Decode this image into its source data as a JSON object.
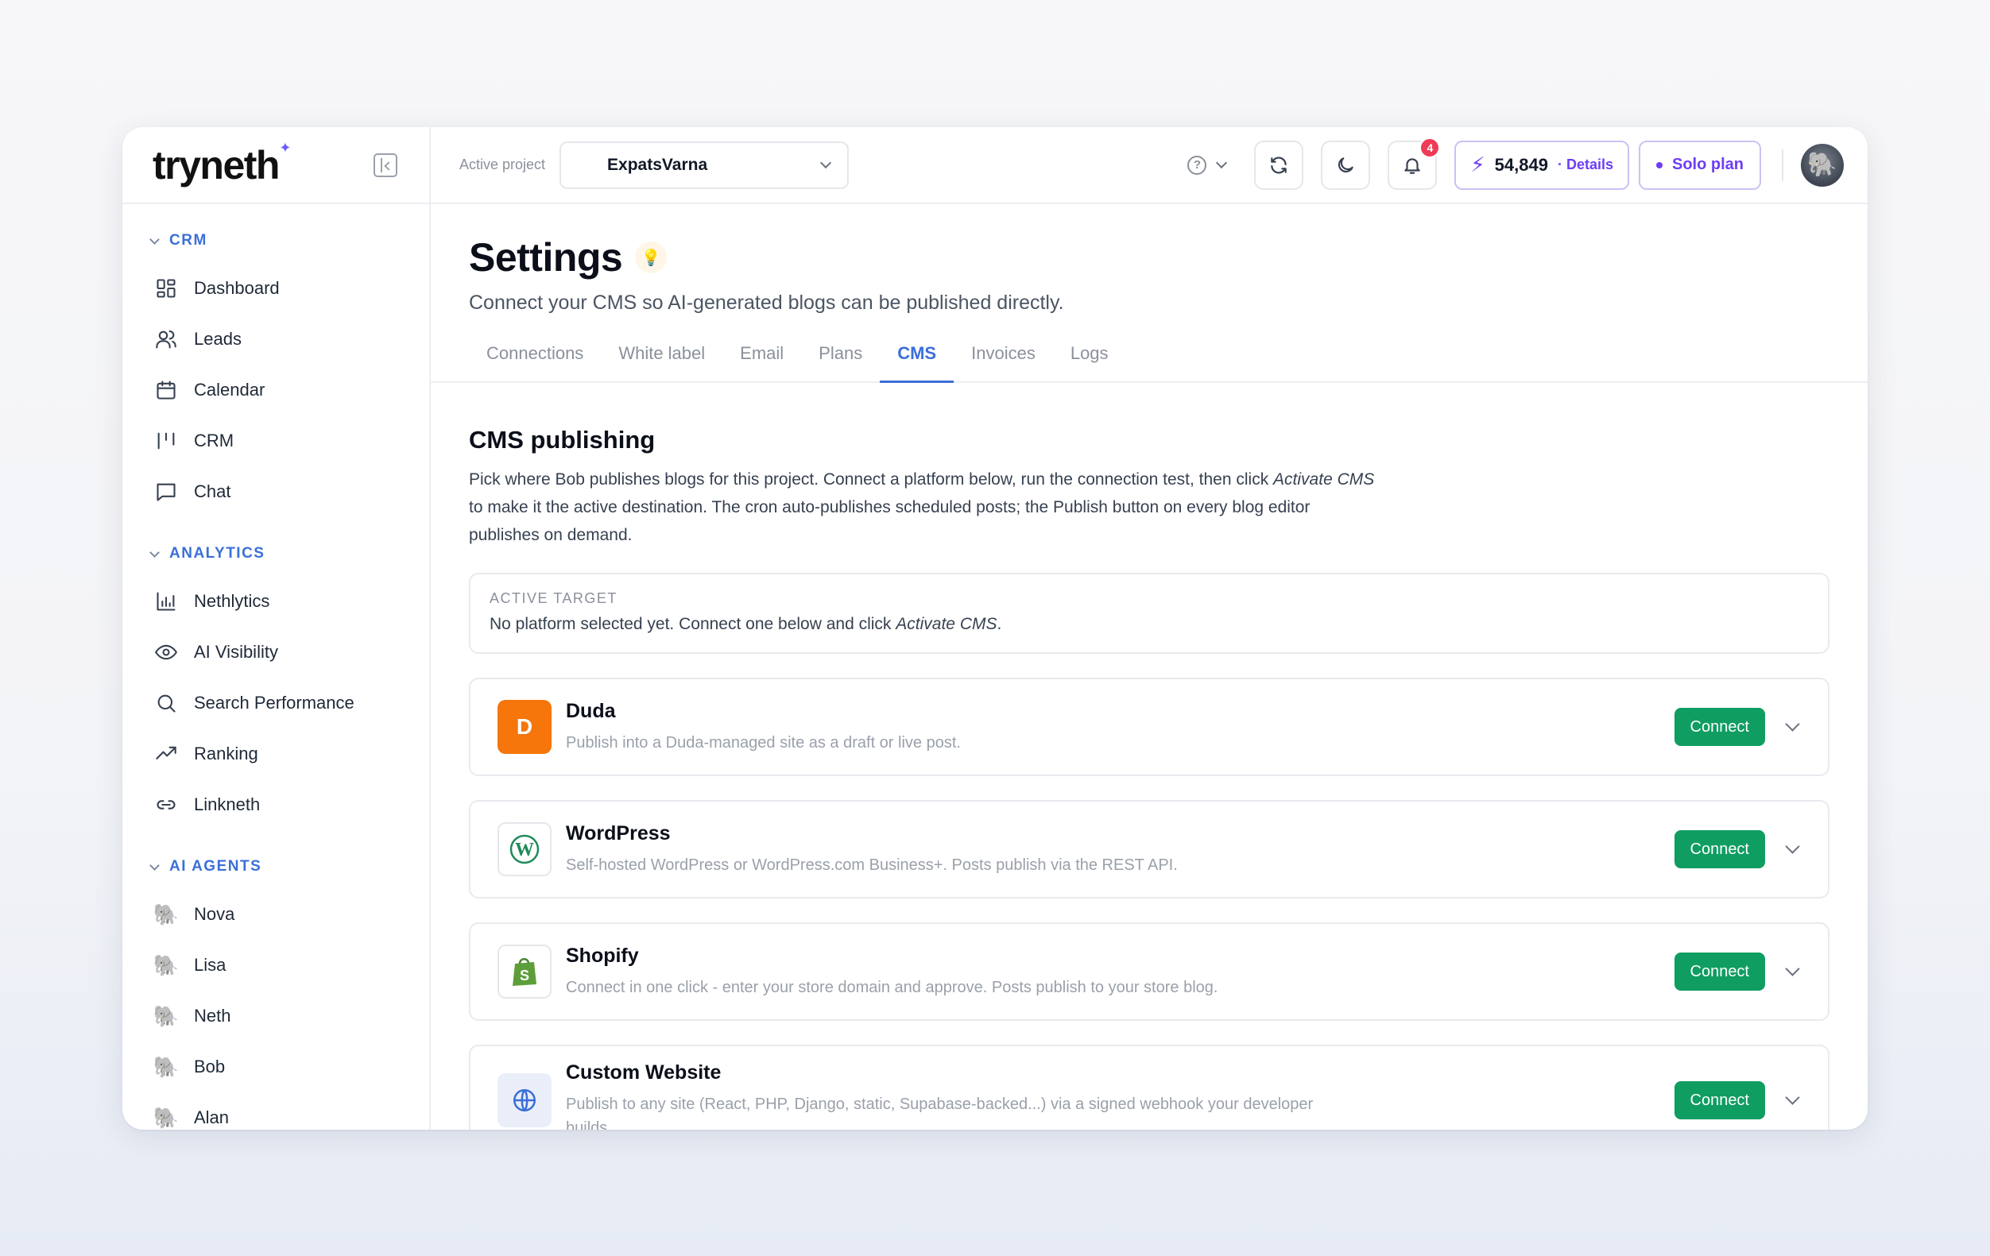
{
  "app": {
    "logo": "tryneth",
    "logo_spark": "✦"
  },
  "sidebar": {
    "sections": [
      {
        "label": "CRM",
        "items": [
          {
            "label": "Dashboard",
            "icon": "dashboard-icon"
          },
          {
            "label": "Leads",
            "icon": "users-icon"
          },
          {
            "label": "Calendar",
            "icon": "calendar-icon"
          },
          {
            "label": "CRM",
            "icon": "kanban-icon"
          },
          {
            "label": "Chat",
            "icon": "chat-icon"
          }
        ]
      },
      {
        "label": "ANALYTICS",
        "items": [
          {
            "label": "Nethlytics",
            "icon": "bar-chart-icon"
          },
          {
            "label": "AI Visibility",
            "icon": "eye-icon"
          },
          {
            "label": "Search Performance",
            "icon": "search-icon"
          },
          {
            "label": "Ranking",
            "icon": "trending-up-icon"
          },
          {
            "label": "Linkneth",
            "icon": "link-icon"
          }
        ]
      },
      {
        "label": "AI AGENTS",
        "items": [
          {
            "label": "Nova",
            "icon": "agent-avatar-icon"
          },
          {
            "label": "Lisa",
            "icon": "agent-avatar-icon"
          },
          {
            "label": "Neth",
            "icon": "agent-avatar-icon"
          },
          {
            "label": "Bob",
            "icon": "agent-avatar-icon"
          },
          {
            "label": "Alan",
            "icon": "agent-avatar-icon"
          }
        ]
      }
    ]
  },
  "topbar": {
    "active_project_label": "Active project",
    "active_project": "ExpatsVarna",
    "notifications_count": "4",
    "credits": "54,849",
    "credits_link": "· Details",
    "plan": "Solo plan"
  },
  "page": {
    "title": "Settings",
    "subtitle": "Connect your CMS so AI-generated blogs can be published directly.",
    "tabs": [
      {
        "label": "Connections",
        "active": false
      },
      {
        "label": "White label",
        "active": false
      },
      {
        "label": "Email",
        "active": false
      },
      {
        "label": "Plans",
        "active": false
      },
      {
        "label": "CMS",
        "active": true
      },
      {
        "label": "Invoices",
        "active": false
      },
      {
        "label": "Logs",
        "active": false
      }
    ]
  },
  "cms": {
    "title": "CMS publishing",
    "desc_1": "Pick where Bob publishes blogs for this project. Connect a platform below, run the connection test, then click ",
    "desc_em": "Activate CMS",
    "desc_2": " to make it the active destination. The cron auto-publishes scheduled posts; the Publish button on every blog editor publishes on demand.",
    "active_target_label": "ACTIVE TARGET",
    "active_target_text": "No platform selected yet. Connect one below and click ",
    "active_target_em": "Activate CMS",
    "active_target_end": ".",
    "connect_label": "Connect",
    "platforms": [
      {
        "name": "Duda",
        "desc": "Publish into a Duda-managed site as a draft or live post.",
        "logo_letter": "D"
      },
      {
        "name": "WordPress",
        "desc": "Self-hosted WordPress or WordPress.com Business+. Posts publish via the REST API."
      },
      {
        "name": "Shopify",
        "desc": "Connect in one click - enter your store domain and approve. Posts publish to your store blog."
      },
      {
        "name": "Custom Website",
        "desc": "Publish to any site (React, PHP, Django, static, Supabase-backed...) via a signed webhook your developer builds."
      }
    ]
  },
  "colors": {
    "accent": "#3b6fd8",
    "brand_purple": "#6d3df5",
    "connect_green": "#0f9d62",
    "duda_orange": "#f6760b",
    "badge_red": "#ef3b57"
  }
}
